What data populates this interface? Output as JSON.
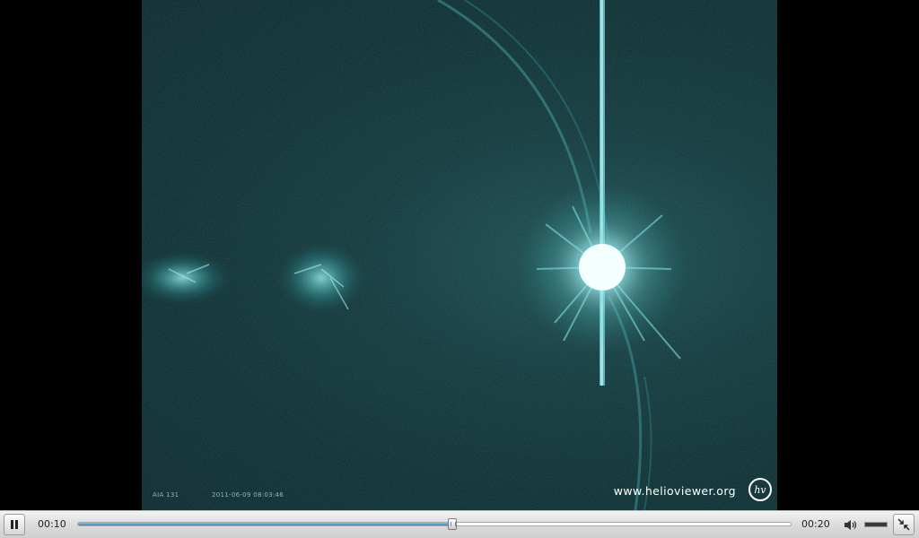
{
  "video": {
    "instrument_label": "AIA 131",
    "timestamp_label": "2011-06-09 08:03:46",
    "watermark": "www.helioviewer.org",
    "logo_text": "hv",
    "colors": {
      "background": "#0b2a2d",
      "flare": "#e6ffff",
      "plasma": "#5fd0d4"
    }
  },
  "controls": {
    "play_state": "playing",
    "pause_icon": "pause-icon",
    "current_time": "00:10",
    "total_time": "00:20",
    "progress": 0.525,
    "volume_icon": "speaker-icon",
    "volume_level": 1.0,
    "fullscreen_icon": "exit-fullscreen-icon",
    "accent_color": "#2c8fcb"
  }
}
